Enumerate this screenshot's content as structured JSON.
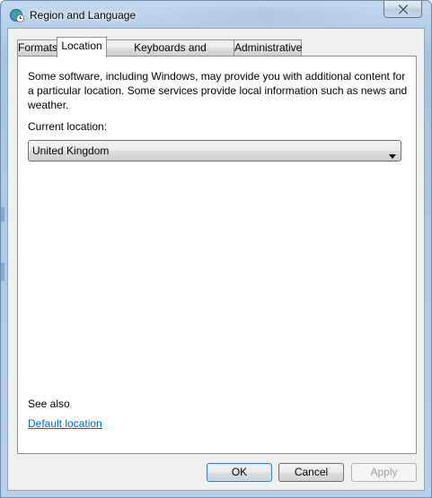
{
  "window": {
    "title": "Region and Language",
    "icon": "globe-clock-icon",
    "close_icon": "close-icon"
  },
  "tabs": [
    {
      "label": "Formats",
      "active": false
    },
    {
      "label": "Location",
      "active": true
    },
    {
      "label": "Keyboards and Languages",
      "active": false
    },
    {
      "label": "Administrative",
      "active": false
    }
  ],
  "location": {
    "description": "Some software, including Windows, may provide you with additional content for a particular location. Some services provide local information such as news and weather.",
    "current_label": "Current location:",
    "current_value": "United Kingdom",
    "see_also": "See also",
    "default_location_link": "Default location"
  },
  "buttons": {
    "ok": "OK",
    "cancel": "Cancel",
    "apply": "Apply"
  },
  "colors": {
    "link": "#0066cc",
    "frame": "#b4cde8",
    "client": "#f0f0f0"
  }
}
